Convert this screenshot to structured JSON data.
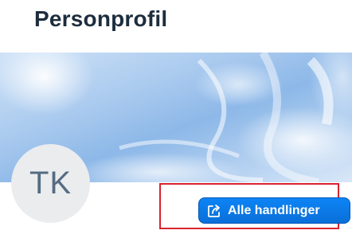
{
  "page": {
    "title": "Personprofil"
  },
  "profile": {
    "initials": "TK"
  },
  "actions": {
    "all_actions_label": "Alle handlinger"
  },
  "colors": {
    "title": "#1d2d3e",
    "button_background": "#0a6ed1",
    "highlight_border": "#d9232e",
    "avatar_background": "#eaecee",
    "avatar_text": "#556b82"
  },
  "icons": {
    "action_button_icon": "share-external-icon"
  }
}
